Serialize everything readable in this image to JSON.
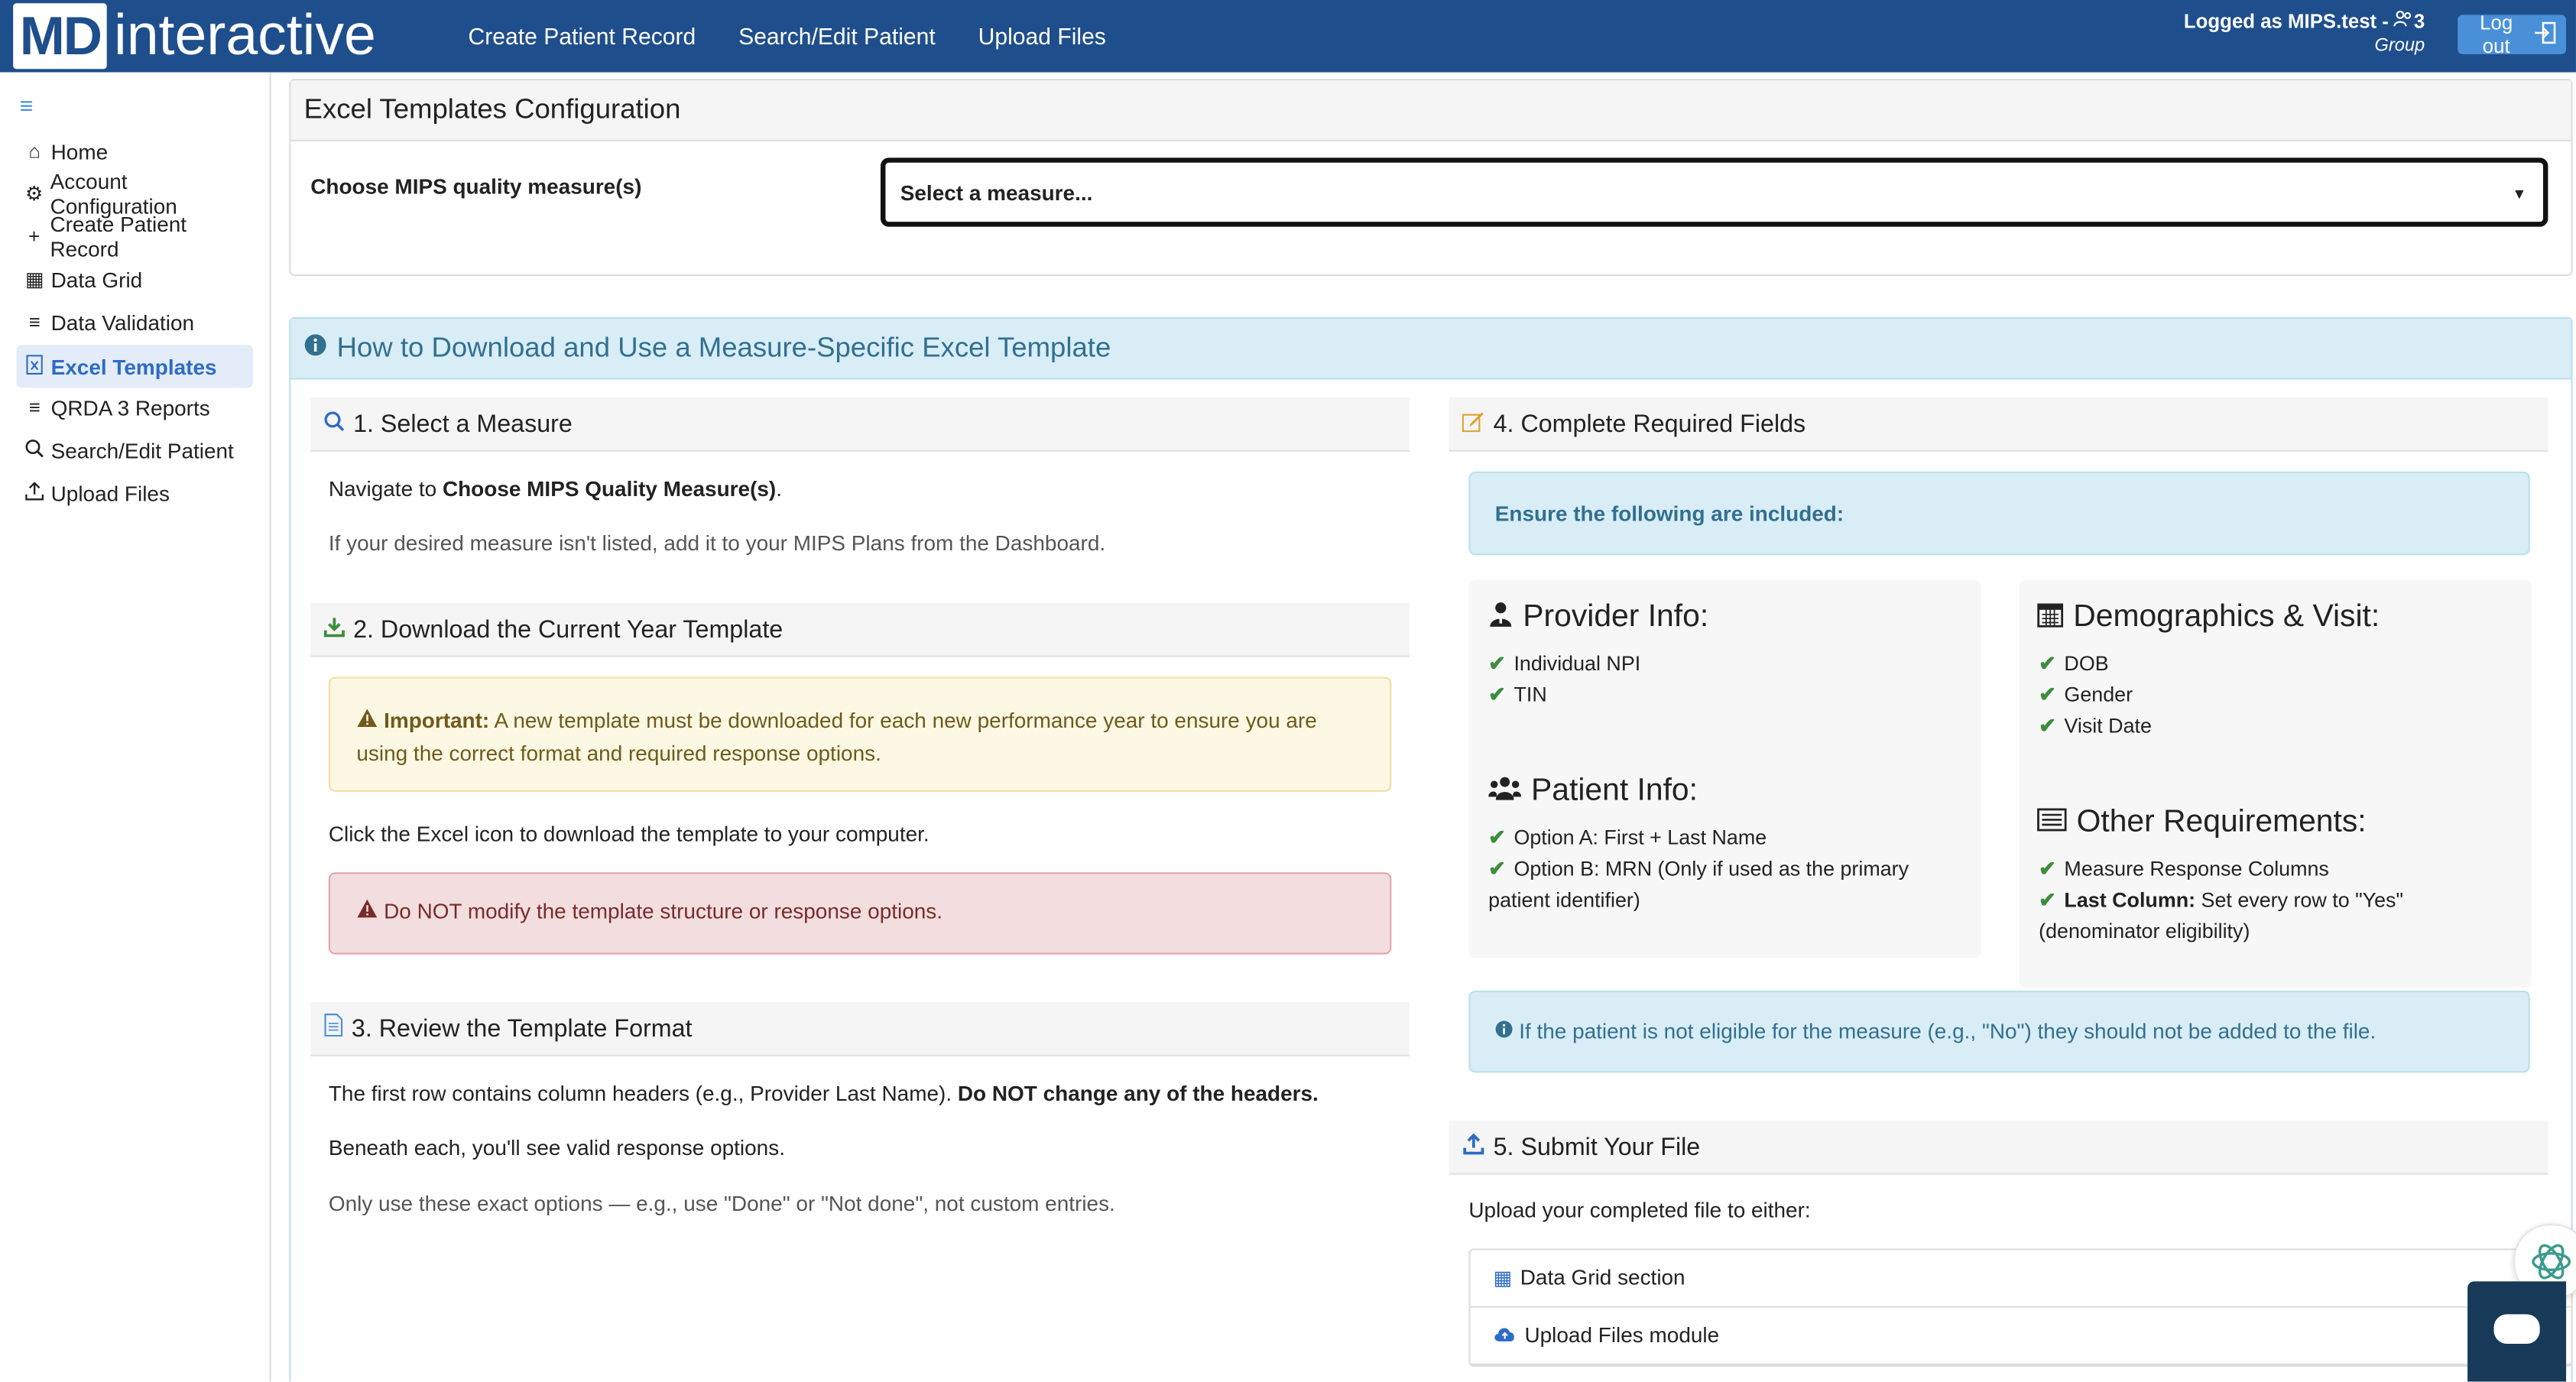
{
  "header": {
    "logo_md": "MD",
    "logo_rest": "interactive",
    "nav": [
      "Create Patient Record",
      "Search/Edit Patient",
      "Upload Files"
    ],
    "user_line": "Logged as MIPS.test - ",
    "user_count": "3",
    "user_role": "Group",
    "logout_label": "Log out"
  },
  "sidebar": {
    "items": [
      {
        "label": "Home",
        "icon": "home-icon"
      },
      {
        "label": "Account Configuration",
        "icon": "gear-icon"
      },
      {
        "label": "Create Patient Record",
        "icon": "plus-icon"
      },
      {
        "label": "Data Grid",
        "icon": "table-icon"
      },
      {
        "label": "Data Validation",
        "icon": "list-icon"
      },
      {
        "label": "Excel Templates",
        "icon": "excel-file-icon",
        "active": true
      },
      {
        "label": "QRDA 3 Reports",
        "icon": "list-icon"
      },
      {
        "label": "Search/Edit Patient",
        "icon": "search-icon"
      },
      {
        "label": "Upload Files",
        "icon": "upload-icon"
      }
    ]
  },
  "config": {
    "title": "Excel Templates Configuration",
    "label": "Choose MIPS quality measure(s)",
    "select_value": "Select a measure..."
  },
  "info": {
    "title": "How to Download and Use a Measure-Specific Excel Template",
    "step1": {
      "title": "1. Select a Measure",
      "line1_prefix": "Navigate to ",
      "line1_bold": "Choose MIPS Quality Measure(s)",
      "line1_suffix": ".",
      "line2": "If your desired measure isn't listed, add it to your MIPS Plans from the Dashboard."
    },
    "step2": {
      "title": "2. Download the Current Year Template",
      "warn_bold": "Important:",
      "warn_text": " A new template must be downloaded for each new performance year to ensure you are using the correct format and required response options.",
      "click_text": "Click the Excel icon to download the template to your computer.",
      "danger_text": "Do NOT modify the template structure or response options."
    },
    "step3": {
      "title": "3. Review the Template Format",
      "line1_prefix": "The first row contains column headers (e.g., Provider Last Name). ",
      "line1_bold": "Do NOT change any of the headers.",
      "line2": "Beneath each, you'll see valid response options.",
      "line3": "Only use these exact options — e.g., use \"Done\" or \"Not done\", not custom entries."
    },
    "step4": {
      "title": "4. Complete Required Fields",
      "ensure": "Ensure the following are included:",
      "provider": {
        "title": "Provider Info:",
        "items": [
          "Individual NPI",
          "TIN"
        ]
      },
      "demographics": {
        "title": "Demographics & Visit:",
        "items": [
          "DOB",
          "Gender",
          "Visit Date"
        ]
      },
      "patient": {
        "title": "Patient Info:",
        "items": [
          "Option A: First + Last Name",
          "Option B: MRN (Only if used as the primary patient identifier)"
        ]
      },
      "other": {
        "title": "Other Requirements:",
        "item1": "Measure Response Columns",
        "item2_bold": "Last Column:",
        "item2_text": " Set every row to \"Yes\" (denominator eligibility)"
      },
      "note": "If the patient is not eligible for the measure (e.g., \"No\") they should not be added to the file."
    },
    "step5": {
      "title": "5. Submit Your File",
      "intro": "Upload your completed file to either:",
      "options": [
        "Data Grid section",
        "Upload Files module"
      ]
    }
  },
  "colors": {
    "nav_bg": "#1f4e8c",
    "accent": "#2d6bc4",
    "info_bg": "#d9edf7",
    "warn_bg": "#fcf8e3",
    "danger_bg": "#f2dede",
    "check": "#3c8d3c"
  }
}
